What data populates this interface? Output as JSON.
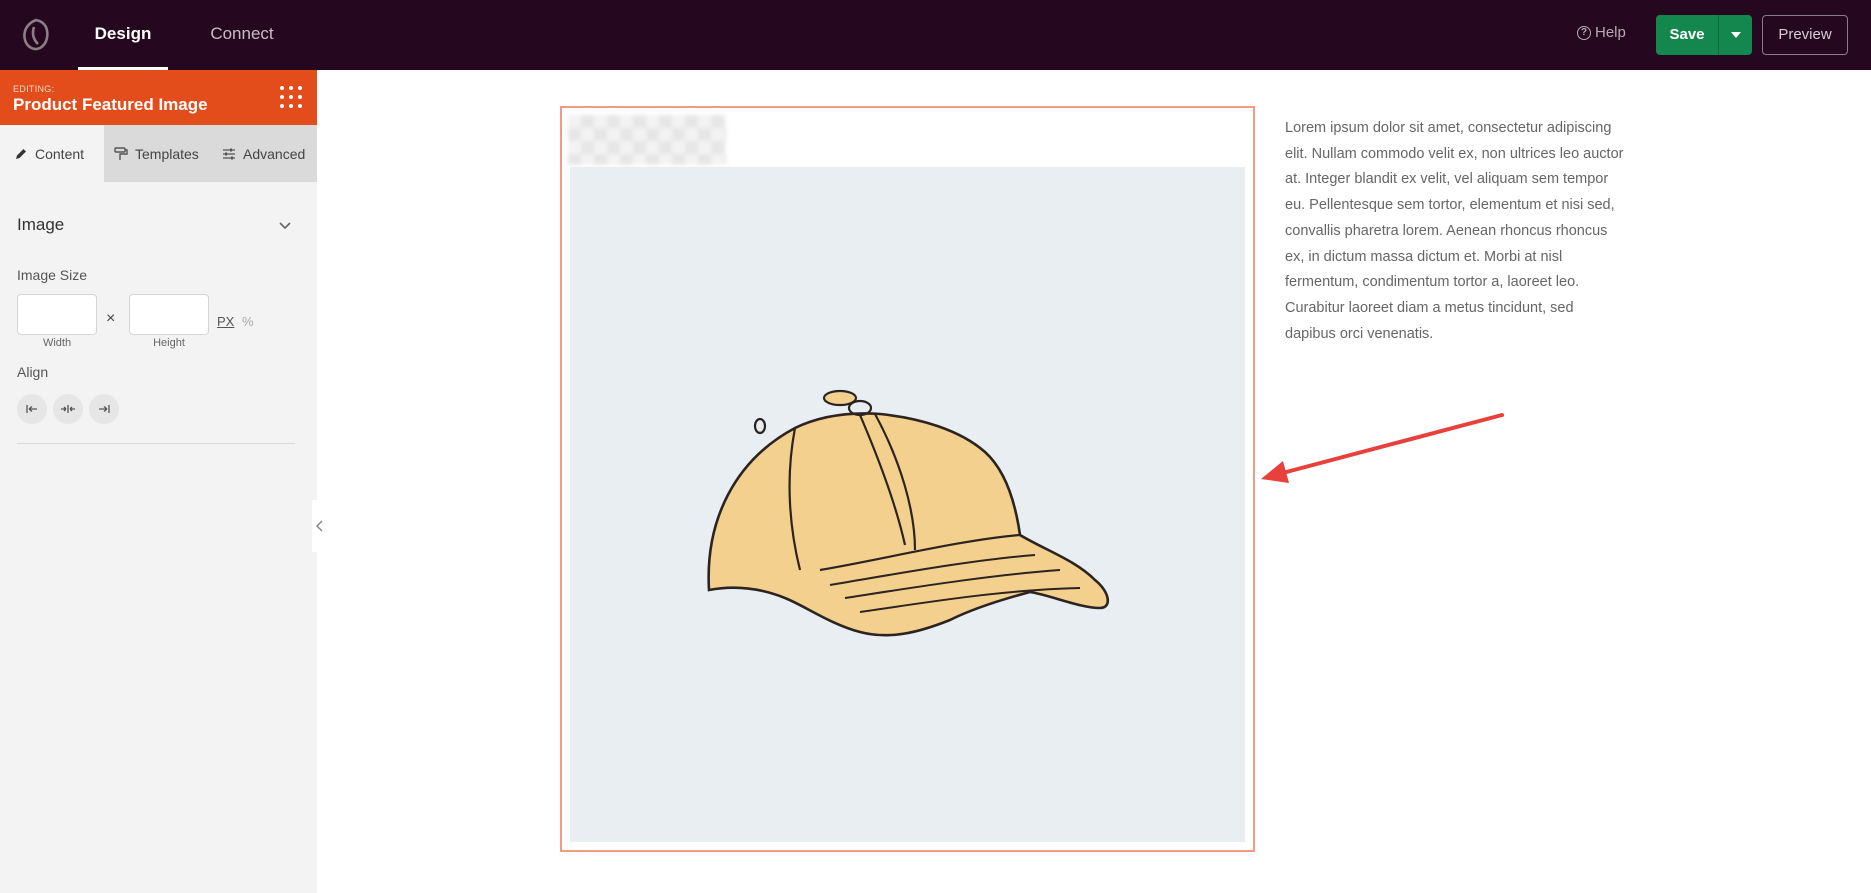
{
  "topbar": {
    "tabs": [
      {
        "label": "Design",
        "active": true
      },
      {
        "label": "Connect",
        "active": false
      }
    ],
    "help_label": "Help",
    "save_label": "Save",
    "preview_label": "Preview"
  },
  "sidebar": {
    "editing_kicker": "EDITING:",
    "editing_title": "Product Featured Image",
    "tabs": [
      {
        "label": "Content",
        "icon": "pencil-icon",
        "active": true
      },
      {
        "label": "Templates",
        "icon": "paint-roller-icon",
        "active": false
      },
      {
        "label": "Advanced",
        "icon": "sliders-icon",
        "active": false
      }
    ],
    "section_title": "Image",
    "image_size_label": "Image Size",
    "width_value": "",
    "height_value": "",
    "width_label": "Width",
    "height_label": "Height",
    "times_symbol": "×",
    "unit_px": "PX",
    "unit_pct": "%",
    "align_label": "Align",
    "align_options": [
      "align-left-icon",
      "align-center-icon",
      "align-right-icon"
    ]
  },
  "canvas": {
    "lorem": "Lorem ipsum dolor sit amet, consectetur adipiscing elit. Nullam commodo velit ex, non ultrices leo auctor at. Integer blandit ex velit, vel aliquam sem tempor eu. Pellentesque sem tortor, elementum et nisi sed, convallis pharetra lorem. Aenean rhoncus rhoncus ex, in dictum massa dictum et. Morbi at nisl fermentum, condimentum tortor a, laoreet leo. Curabitur laoreet diam a metus tincidunt, sed dapibus orci venenatis."
  },
  "colors": {
    "topbar_bg": "#25081f",
    "accent_orange": "#e34d1b",
    "save_green": "#14874f",
    "frame_border": "#f19c82",
    "arrow_red": "#e8403a"
  }
}
